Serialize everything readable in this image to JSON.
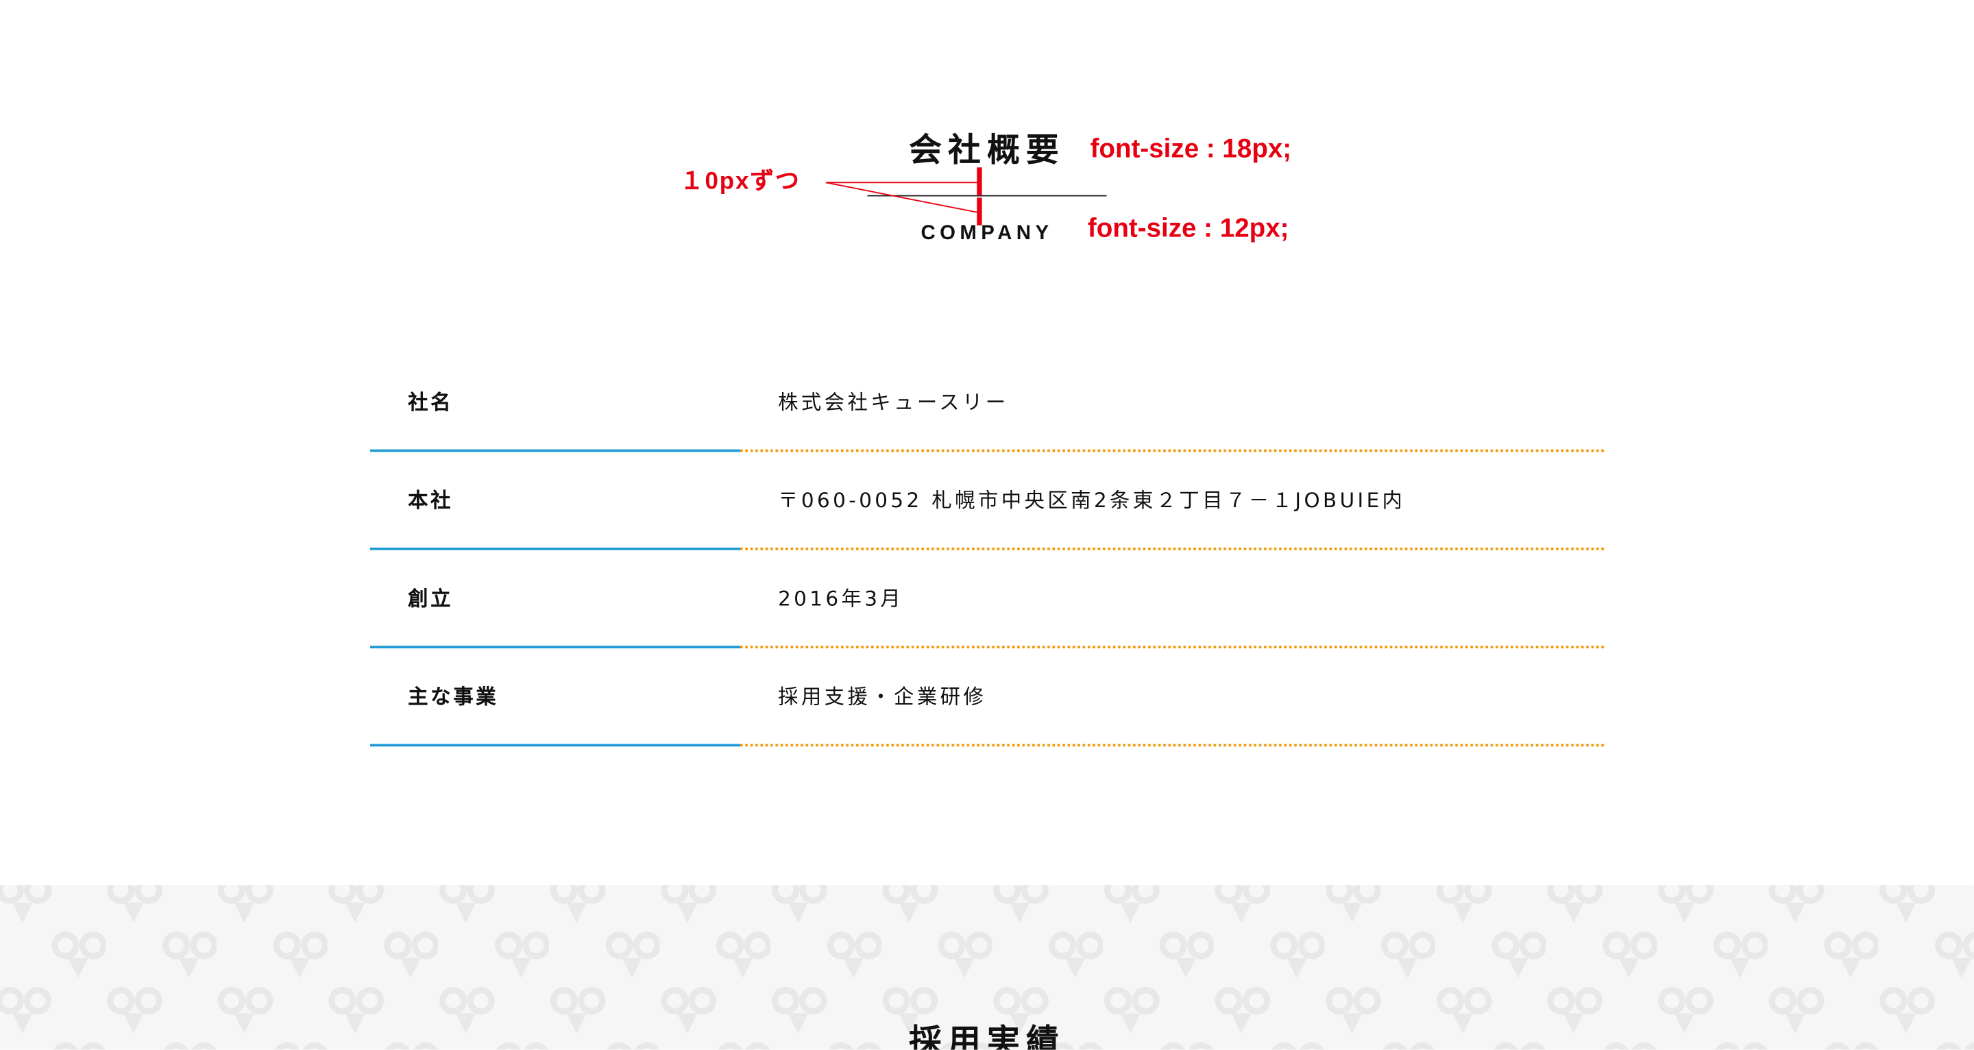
{
  "section_heading": {
    "title_jp": "会社概要",
    "title_en": "COMPANY"
  },
  "annotations": {
    "spacing_note": "１0pxずつ",
    "title_font_size": "font-size : 18px;",
    "subtitle_font_size": "font-size : 12px;",
    "color": "#e60012"
  },
  "company_info": {
    "rows": [
      {
        "label": "社名",
        "value": "株式会社キュースリー"
      },
      {
        "label": "本社",
        "value": "〒060-0052 札幌市中央区南2条東２丁目７－１JOBUIE内"
      },
      {
        "label": "創立",
        "value": "2016年3月"
      },
      {
        "label": "主な事業",
        "value": "採用支援・企業研修"
      }
    ],
    "label_rule_color": "#1e9ad6",
    "value_rule_color": "#f39800"
  },
  "next_section": {
    "title": "採用実績",
    "background_icon": "speech-bubble-pattern-icon"
  }
}
